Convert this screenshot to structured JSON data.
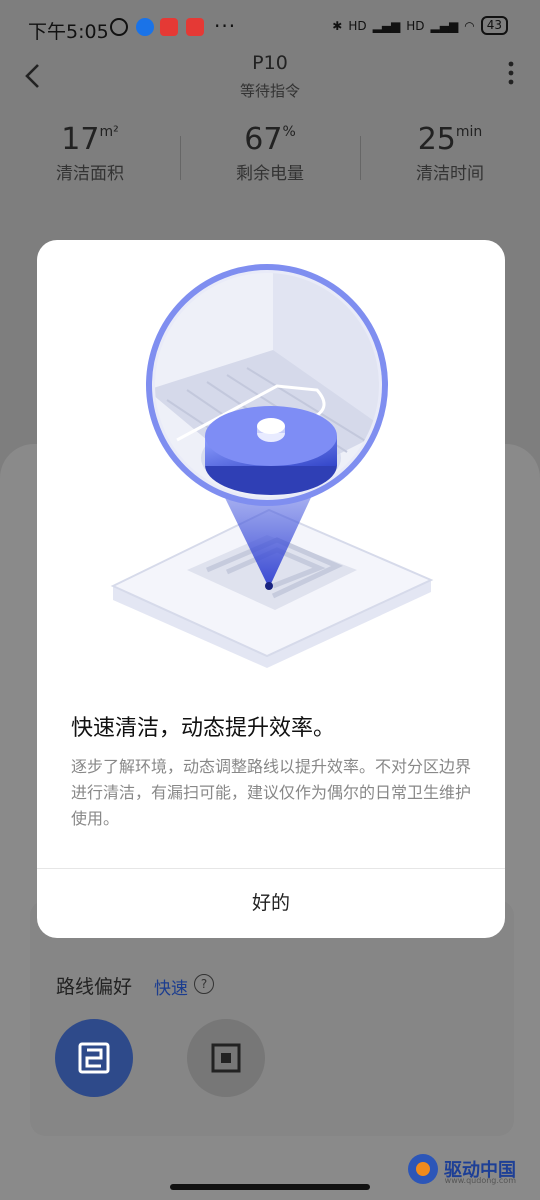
{
  "status_bar": {
    "time": "下午5:05",
    "battery": "43",
    "overflow": "···",
    "net1": "HD",
    "net2": "HD"
  },
  "header": {
    "device_name": "P10",
    "device_status": "等待指令"
  },
  "stats": [
    {
      "value": "17",
      "unit": "m²",
      "label": "清洁面积"
    },
    {
      "value": "67",
      "unit": "%",
      "label": "剩余电量"
    },
    {
      "value": "25",
      "unit": "min",
      "label": "清洁时间"
    }
  ],
  "route": {
    "label": "路线偏好",
    "value": "快速"
  },
  "dialog": {
    "title": "快速清洁，动态提升效率。",
    "body": "逐步了解环境，动态调整路线以提升效率。不对分区边界进行清洁，有漏扫可能，建议仅作为偶尔的日常卫生维护使用。",
    "confirm": "好的"
  },
  "watermark": {
    "text": "驱动中国",
    "sub": "www.qudong.com"
  },
  "icons": {
    "back": "chevron-left-icon",
    "menu": "more-vertical-icon",
    "help": "question-icon",
    "opt1": "route-fast-icon",
    "opt2": "route-square-icon"
  }
}
